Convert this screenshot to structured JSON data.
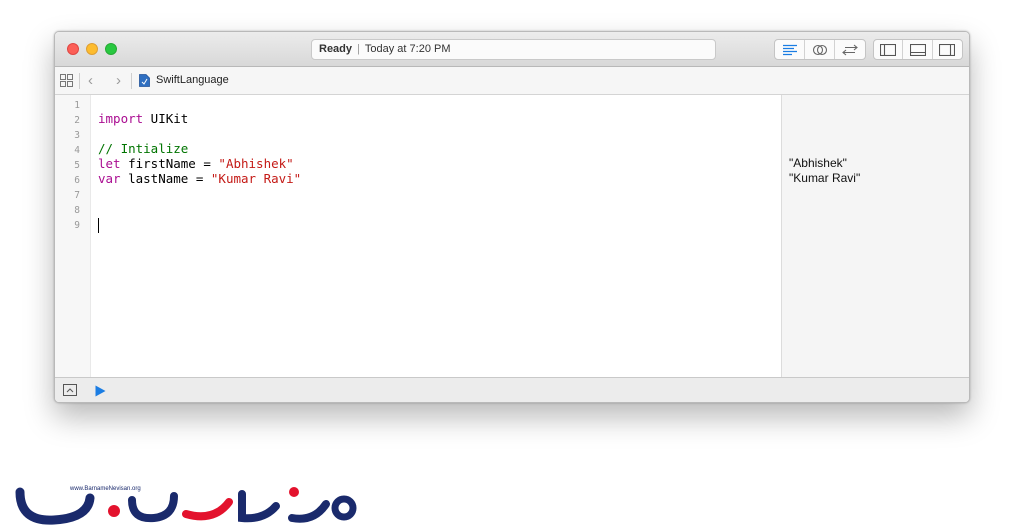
{
  "titlebar": {
    "status": "Ready",
    "separator": "|",
    "timestamp": "Today at 7:20 PM"
  },
  "toolbar": {
    "editor_icons": [
      "standard-editor-icon",
      "assistant-editor-icon",
      "version-editor-icon"
    ],
    "view_icons": [
      "navigator-toggle-icon",
      "debug-area-toggle-icon",
      "utilities-toggle-icon"
    ]
  },
  "jumpbar": {
    "file_name": "SwiftLanguage"
  },
  "editor": {
    "line_numbers": [
      "1",
      "2",
      "3",
      "4",
      "5",
      "6",
      "7",
      "8",
      "9"
    ],
    "lines": {
      "l2_kw": "import",
      "l2_rest": " UIKit",
      "l4_comment": "// Intialize",
      "l5_kw": "let",
      "l5_mid": " firstName = ",
      "l5_str": "\"Abhishek\"",
      "l6_kw": "var",
      "l6_mid": " lastName = ",
      "l6_str": "\"Kumar Ravi\""
    }
  },
  "results": {
    "r5": "\"Abhishek\"",
    "r6": "\"Kumar Ravi\""
  },
  "colors": {
    "keyword": "#aa0d91",
    "comment": "#007400",
    "string": "#c41a16",
    "run_button": "#1b7de3",
    "logo_red": "#e3122d",
    "logo_navy": "#1a2a6c"
  },
  "watermark": {
    "url": "www.BarnameNevisan.org"
  }
}
